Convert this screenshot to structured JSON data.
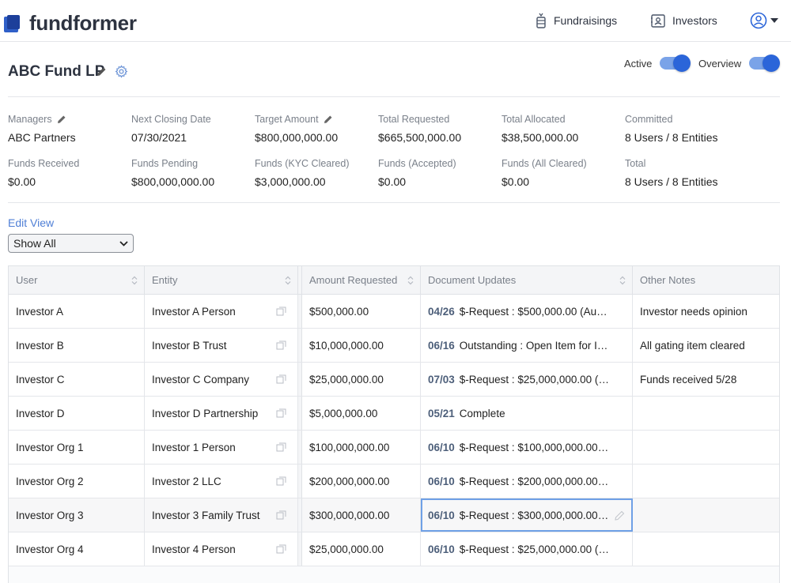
{
  "brand": {
    "name": "fundformer"
  },
  "nav": {
    "fundraisings": "Fundraisings",
    "investors": "Investors"
  },
  "fund": {
    "title": "ABC Fund LP"
  },
  "toggles": {
    "active": "Active",
    "overview": "Overview"
  },
  "stats": [
    {
      "label": "Managers",
      "value": "ABC Partners",
      "editable": true
    },
    {
      "label": "Next Closing Date",
      "value": "07/30/2021",
      "editable": false
    },
    {
      "label": "Target Amount",
      "value": "$800,000,000.00",
      "editable": true
    },
    {
      "label": "Total Requested",
      "value": "$665,500,000.00",
      "editable": false
    },
    {
      "label": "Total Allocated",
      "value": "$38,500,000.00",
      "editable": false
    },
    {
      "label": "Committed",
      "value": "8 Users / 8 Entities",
      "editable": false
    },
    {
      "label": "Funds Received",
      "value": "$0.00",
      "editable": false
    },
    {
      "label": "Funds Pending",
      "value": "$800,000,000.00",
      "editable": false
    },
    {
      "label": "Funds (KYC Cleared)",
      "value": "$3,000,000.00",
      "editable": false
    },
    {
      "label": "Funds (Accepted)",
      "value": "$0.00",
      "editable": false
    },
    {
      "label": "Funds (All Cleared)",
      "value": "$0.00",
      "editable": false
    },
    {
      "label": "Total",
      "value": "8 Users / 8 Entities",
      "editable": false
    }
  ],
  "view": {
    "edit_label": "Edit View",
    "selected": "Show All"
  },
  "table": {
    "headers": {
      "user": "User",
      "entity": "Entity",
      "amount": "Amount Requested",
      "doc": "Document Updates",
      "notes": "Other Notes"
    },
    "rows": [
      {
        "user": "Investor A",
        "entity": "Investor A Person",
        "amount": "$500,000.00",
        "doc_date": "04/26",
        "doc_text": "$-Request : $500,000.00 (Auto...",
        "notes": "Investor needs opinion"
      },
      {
        "user": "Investor B",
        "entity": "Investor B Trust",
        "amount": "$10,000,000.00",
        "doc_date": "06/16",
        "doc_text": "Outstanding : Open Item for In...",
        "notes": "All gating item cleared"
      },
      {
        "user": "Investor C",
        "entity": "Investor C Company",
        "amount": "$25,000,000.00",
        "doc_date": "07/03",
        "doc_text": "$-Request : $25,000,000.00 (A...",
        "notes": "Funds received 5/28"
      },
      {
        "user": "Investor D",
        "entity": "Investor D Partnership",
        "amount": "$5,000,000.00",
        "doc_date": "05/21",
        "doc_text": "Complete",
        "notes": ""
      },
      {
        "user": "Investor Org 1",
        "entity": "Investor 1 Person",
        "amount": "$100,000,000.00",
        "doc_date": "06/10",
        "doc_text": "$-Request : $100,000,000.00 (...",
        "notes": ""
      },
      {
        "user": "Investor Org 2",
        "entity": "Investor 2 LLC",
        "amount": "$200,000,000.00",
        "doc_date": "06/10",
        "doc_text": "$-Request : $200,000,000.00 (...",
        "notes": ""
      },
      {
        "user": "Investor Org 3",
        "entity": "Investor 3 Family Trust",
        "amount": "$300,000,000.00",
        "doc_date": "06/10",
        "doc_text": "$-Request : $300,000,000.00 (...",
        "notes": ""
      },
      {
        "user": "Investor Org 4",
        "entity": "Investor 4 Person",
        "amount": "$25,000,000.00",
        "doc_date": "06/10",
        "doc_text": "$-Request : $25,000,000.00 (A...",
        "notes": ""
      }
    ]
  },
  "colors": {
    "accent": "#2b65d9",
    "link": "#4f7fd6",
    "brand": "#1d3f9a"
  }
}
